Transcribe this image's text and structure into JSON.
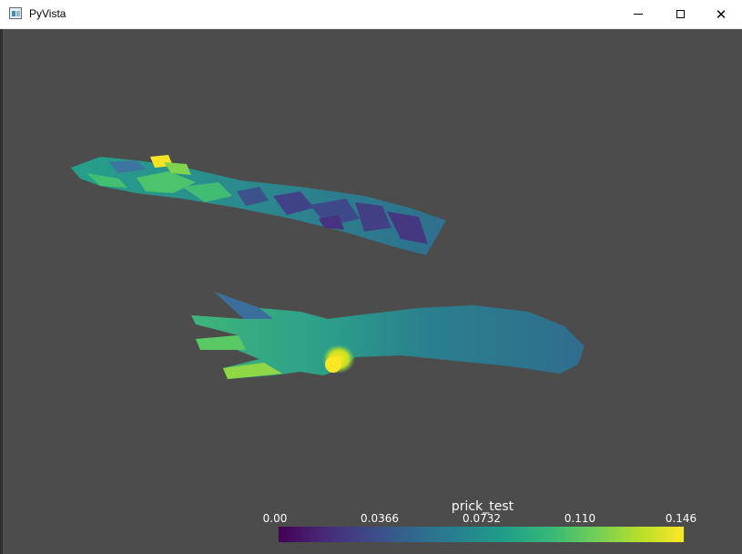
{
  "window": {
    "title": "PyVista",
    "icon": "pyvista-app-icon",
    "controls": {
      "minimize": "minimize-icon",
      "maximize": "maximize-icon",
      "close": "close-icon",
      "close_glyph": "✕"
    }
  },
  "scene": {
    "background": "#4c4c4c",
    "meshes": [
      "arm-mesh-wireframe-patches",
      "arm-mesh-smooth"
    ]
  },
  "scalar_bar": {
    "title": "prick_test",
    "colormap": "viridis",
    "ticks": [
      "0.00",
      "0.0366",
      "0.0732",
      "0.110",
      "0.146"
    ],
    "range": [
      0.0,
      0.146
    ]
  }
}
